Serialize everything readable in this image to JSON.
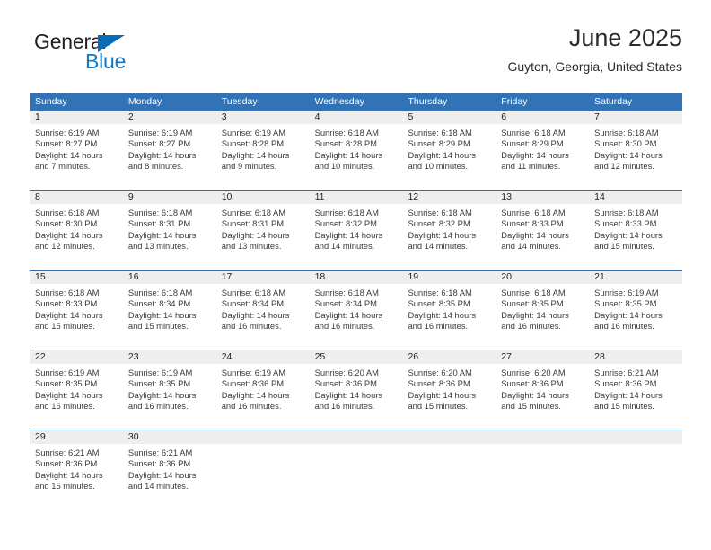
{
  "brand": {
    "name_part1": "General",
    "name_part2": "Blue",
    "triangle_icon": "blue-triangle-icon",
    "color_dark": "#231f20",
    "color_blue": "#1379c4"
  },
  "header": {
    "title": "June 2025",
    "subtitle": "Guyton, Georgia, United States"
  },
  "theme": {
    "header_bg": "#3273b5",
    "header_text": "#ffffff",
    "row_divider": "#2b6ca8",
    "daynum_bar_bg": "#eeeeee",
    "body_text": "#3a3a3a"
  },
  "calendar": {
    "day_headers": [
      "Sunday",
      "Monday",
      "Tuesday",
      "Wednesday",
      "Thursday",
      "Friday",
      "Saturday"
    ],
    "weeks": [
      [
        {
          "day": "1",
          "lines": [
            "Sunrise: 6:19 AM",
            "Sunset: 8:27 PM",
            "Daylight: 14 hours",
            "and 7 minutes."
          ]
        },
        {
          "day": "2",
          "lines": [
            "Sunrise: 6:19 AM",
            "Sunset: 8:27 PM",
            "Daylight: 14 hours",
            "and 8 minutes."
          ]
        },
        {
          "day": "3",
          "lines": [
            "Sunrise: 6:19 AM",
            "Sunset: 8:28 PM",
            "Daylight: 14 hours",
            "and 9 minutes."
          ]
        },
        {
          "day": "4",
          "lines": [
            "Sunrise: 6:18 AM",
            "Sunset: 8:28 PM",
            "Daylight: 14 hours",
            "and 10 minutes."
          ]
        },
        {
          "day": "5",
          "lines": [
            "Sunrise: 6:18 AM",
            "Sunset: 8:29 PM",
            "Daylight: 14 hours",
            "and 10 minutes."
          ]
        },
        {
          "day": "6",
          "lines": [
            "Sunrise: 6:18 AM",
            "Sunset: 8:29 PM",
            "Daylight: 14 hours",
            "and 11 minutes."
          ]
        },
        {
          "day": "7",
          "lines": [
            "Sunrise: 6:18 AM",
            "Sunset: 8:30 PM",
            "Daylight: 14 hours",
            "and 12 minutes."
          ]
        }
      ],
      [
        {
          "day": "8",
          "lines": [
            "Sunrise: 6:18 AM",
            "Sunset: 8:30 PM",
            "Daylight: 14 hours",
            "and 12 minutes."
          ]
        },
        {
          "day": "9",
          "lines": [
            "Sunrise: 6:18 AM",
            "Sunset: 8:31 PM",
            "Daylight: 14 hours",
            "and 13 minutes."
          ]
        },
        {
          "day": "10",
          "lines": [
            "Sunrise: 6:18 AM",
            "Sunset: 8:31 PM",
            "Daylight: 14 hours",
            "and 13 minutes."
          ]
        },
        {
          "day": "11",
          "lines": [
            "Sunrise: 6:18 AM",
            "Sunset: 8:32 PM",
            "Daylight: 14 hours",
            "and 14 minutes."
          ]
        },
        {
          "day": "12",
          "lines": [
            "Sunrise: 6:18 AM",
            "Sunset: 8:32 PM",
            "Daylight: 14 hours",
            "and 14 minutes."
          ]
        },
        {
          "day": "13",
          "lines": [
            "Sunrise: 6:18 AM",
            "Sunset: 8:33 PM",
            "Daylight: 14 hours",
            "and 14 minutes."
          ]
        },
        {
          "day": "14",
          "lines": [
            "Sunrise: 6:18 AM",
            "Sunset: 8:33 PM",
            "Daylight: 14 hours",
            "and 15 minutes."
          ]
        }
      ],
      [
        {
          "day": "15",
          "lines": [
            "Sunrise: 6:18 AM",
            "Sunset: 8:33 PM",
            "Daylight: 14 hours",
            "and 15 minutes."
          ]
        },
        {
          "day": "16",
          "lines": [
            "Sunrise: 6:18 AM",
            "Sunset: 8:34 PM",
            "Daylight: 14 hours",
            "and 15 minutes."
          ]
        },
        {
          "day": "17",
          "lines": [
            "Sunrise: 6:18 AM",
            "Sunset: 8:34 PM",
            "Daylight: 14 hours",
            "and 16 minutes."
          ]
        },
        {
          "day": "18",
          "lines": [
            "Sunrise: 6:18 AM",
            "Sunset: 8:34 PM",
            "Daylight: 14 hours",
            "and 16 minutes."
          ]
        },
        {
          "day": "19",
          "lines": [
            "Sunrise: 6:18 AM",
            "Sunset: 8:35 PM",
            "Daylight: 14 hours",
            "and 16 minutes."
          ]
        },
        {
          "day": "20",
          "lines": [
            "Sunrise: 6:18 AM",
            "Sunset: 8:35 PM",
            "Daylight: 14 hours",
            "and 16 minutes."
          ]
        },
        {
          "day": "21",
          "lines": [
            "Sunrise: 6:19 AM",
            "Sunset: 8:35 PM",
            "Daylight: 14 hours",
            "and 16 minutes."
          ]
        }
      ],
      [
        {
          "day": "22",
          "lines": [
            "Sunrise: 6:19 AM",
            "Sunset: 8:35 PM",
            "Daylight: 14 hours",
            "and 16 minutes."
          ]
        },
        {
          "day": "23",
          "lines": [
            "Sunrise: 6:19 AM",
            "Sunset: 8:35 PM",
            "Daylight: 14 hours",
            "and 16 minutes."
          ]
        },
        {
          "day": "24",
          "lines": [
            "Sunrise: 6:19 AM",
            "Sunset: 8:36 PM",
            "Daylight: 14 hours",
            "and 16 minutes."
          ]
        },
        {
          "day": "25",
          "lines": [
            "Sunrise: 6:20 AM",
            "Sunset: 8:36 PM",
            "Daylight: 14 hours",
            "and 16 minutes."
          ]
        },
        {
          "day": "26",
          "lines": [
            "Sunrise: 6:20 AM",
            "Sunset: 8:36 PM",
            "Daylight: 14 hours",
            "and 15 minutes."
          ]
        },
        {
          "day": "27",
          "lines": [
            "Sunrise: 6:20 AM",
            "Sunset: 8:36 PM",
            "Daylight: 14 hours",
            "and 15 minutes."
          ]
        },
        {
          "day": "28",
          "lines": [
            "Sunrise: 6:21 AM",
            "Sunset: 8:36 PM",
            "Daylight: 14 hours",
            "and 15 minutes."
          ]
        }
      ],
      [
        {
          "day": "29",
          "lines": [
            "Sunrise: 6:21 AM",
            "Sunset: 8:36 PM",
            "Daylight: 14 hours",
            "and 15 minutes."
          ]
        },
        {
          "day": "30",
          "lines": [
            "Sunrise: 6:21 AM",
            "Sunset: 8:36 PM",
            "Daylight: 14 hours",
            "and 14 minutes."
          ]
        },
        {
          "day": "",
          "lines": []
        },
        {
          "day": "",
          "lines": []
        },
        {
          "day": "",
          "lines": []
        },
        {
          "day": "",
          "lines": []
        },
        {
          "day": "",
          "lines": []
        }
      ]
    ]
  }
}
